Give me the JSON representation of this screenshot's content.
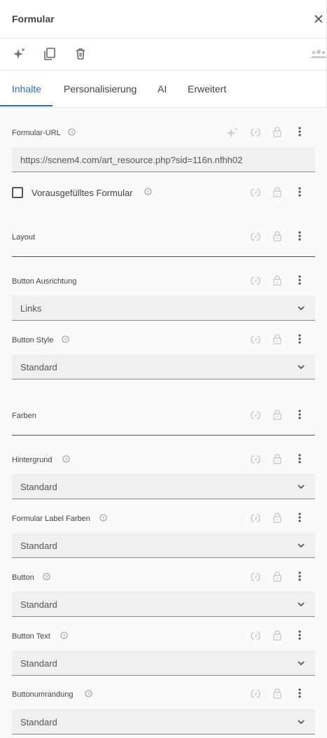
{
  "header": {
    "title": "Formular"
  },
  "tabs": [
    {
      "label": "Inhalte",
      "active": true
    },
    {
      "label": "Personalisierung",
      "active": false
    },
    {
      "label": "AI",
      "active": false
    },
    {
      "label": "Erweitert",
      "active": false
    }
  ],
  "form_url": {
    "label": "Formular-URL",
    "value": "https://scnem4.com/art_resource.php?sid=116n.nfhh02"
  },
  "prefilled": {
    "label": "Vorausgefülltes Formular",
    "checked": false
  },
  "sections": {
    "layout": "Layout",
    "colors": "Farben"
  },
  "button_alignment": {
    "label": "Button Ausrichtung",
    "value": "Links"
  },
  "button_style": {
    "label": "Button Style",
    "value": "Standard"
  },
  "background": {
    "label": "Hintergrund",
    "value": "Standard"
  },
  "label_colors": {
    "label": "Formular Label Farben",
    "value": "Standard"
  },
  "button": {
    "label": "Button",
    "value": "Standard"
  },
  "button_text": {
    "label": "Button Text",
    "value": "Standard"
  },
  "button_border": {
    "label": "Buttonumrandung",
    "value": "Standard"
  },
  "colors": {
    "accent": "#2f6db3",
    "icon": "#777777",
    "icon_light": "#c8c8c8"
  }
}
